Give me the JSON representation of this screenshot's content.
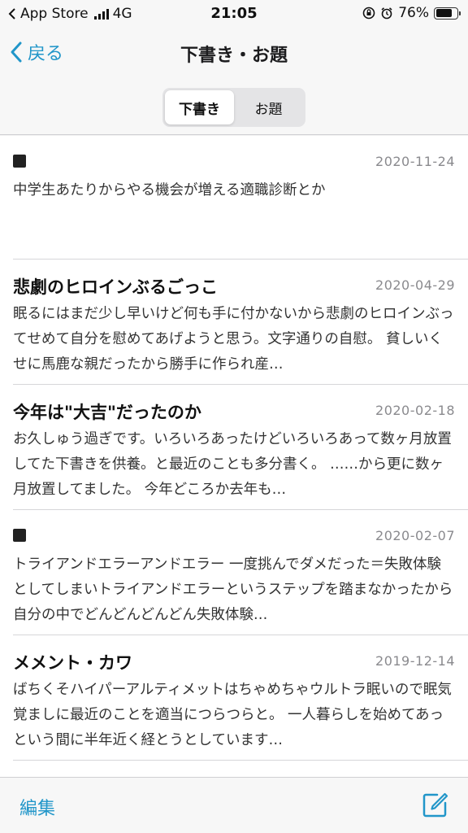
{
  "status_bar": {
    "carrier": "App Store",
    "network": "4G",
    "time": "21:05",
    "battery": "76%",
    "battery_level": 0.76
  },
  "nav": {
    "back_label": "戻る",
    "title": "下書き・お題",
    "segments": [
      {
        "label": "下書き",
        "active": true
      },
      {
        "label": "お題",
        "active": false
      }
    ]
  },
  "entries": [
    {
      "title": "",
      "title_icon": "square-icon",
      "date": "2020-11-24",
      "body": "中学生あたりからやる機会が増える適職診断とか"
    },
    {
      "title": "悲劇のヒロインぶるごっこ",
      "date": "2020-04-29",
      "body": "眠るにはまだ少し早いけど何も手に付かないから悲劇のヒロインぶってせめて自分を慰めてあげようと思う。文字通りの自慰。 貧しいくせに馬鹿な親だったから勝手に作られ産…"
    },
    {
      "title": "今年は\"大吉\"だったのか",
      "date": "2020-02-18",
      "body": "お久しゅう過ぎです。いろいろあったけどいろいろあって数ヶ月放置してた下書きを供養。と最近のことも多分書く。 ……から更に数ヶ月放置してました。 今年どころか去年も…"
    },
    {
      "title": "",
      "title_icon": "square-icon",
      "date": "2020-02-07",
      "body": "トライアンドエラーアンドエラー 一度挑んでダメだった＝失敗体験 としてしまいトライアンドエラーというステップを踏まなかったから自分の中でどんどんどんどん失敗体験…"
    },
    {
      "title": "メメント・カワ",
      "date": "2019-12-14",
      "body": "ばちくそハイパーアルティメットはちゃめちゃウルトラ眠いので眠気覚ましに最近のことを適当につらつらと。 一人暮らしを始めてあっという間に半年近く経とうとしています…"
    }
  ],
  "toolbar": {
    "edit_label": "編集",
    "compose_icon": "compose-icon"
  },
  "colors": {
    "accent": "#2196c9"
  }
}
